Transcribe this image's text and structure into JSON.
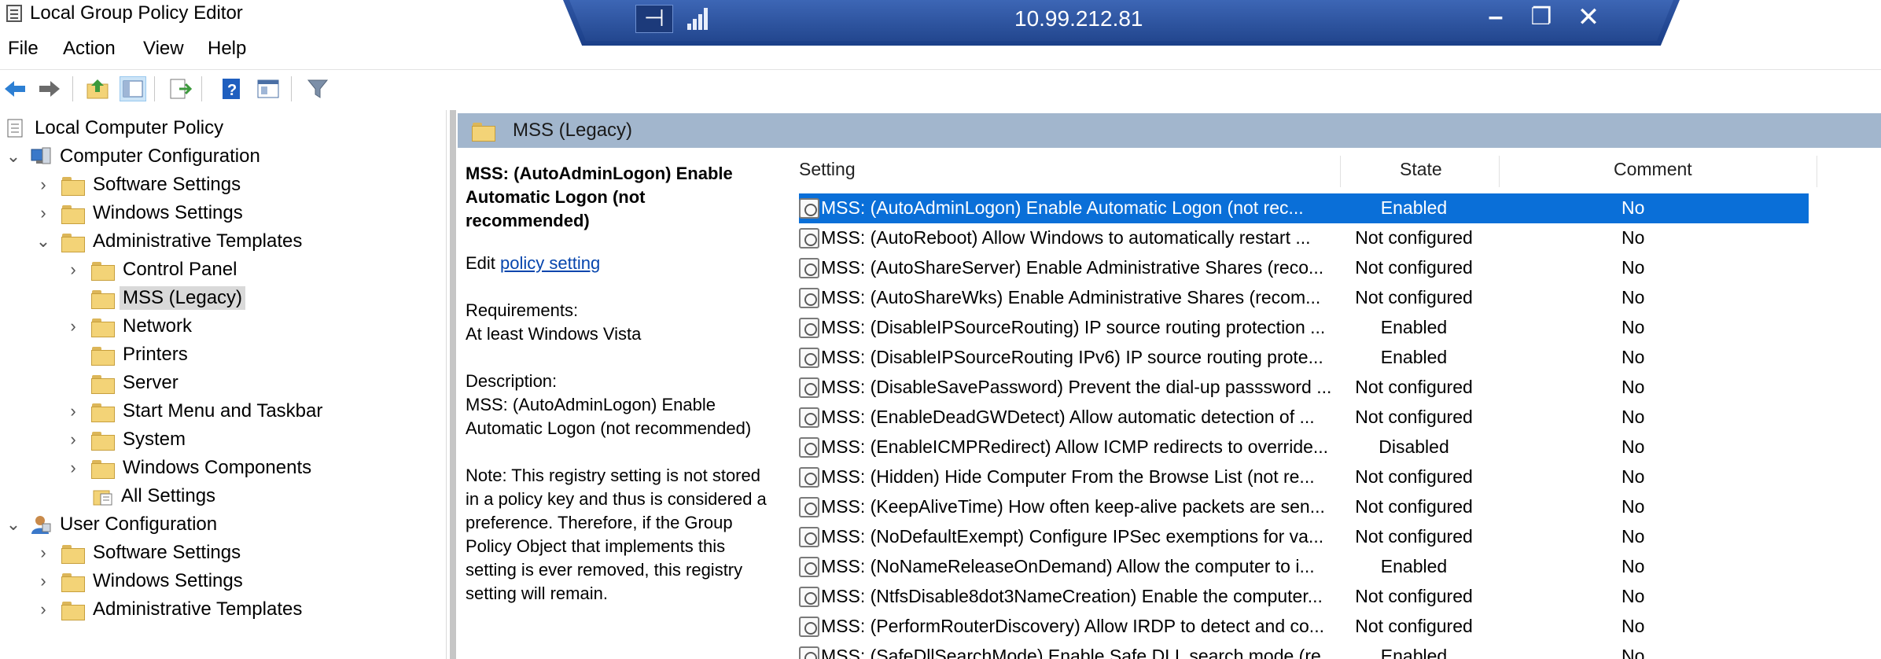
{
  "window": {
    "title": "Local Group Policy Editor"
  },
  "remote_bar": {
    "host": "10.99.212.81",
    "pin_icon": "pin-icon",
    "signal_icon": "signal-icon",
    "minimize": "–",
    "restore": "❐",
    "close": "✕"
  },
  "menu": {
    "file": "File",
    "action": "Action",
    "view": "View",
    "help": "Help"
  },
  "tree": {
    "root": "Local Computer Policy",
    "computer_configuration": "Computer Configuration",
    "cc_software_settings": "Software Settings",
    "cc_windows_settings": "Windows Settings",
    "cc_admin_templates": "Administrative Templates",
    "control_panel": "Control Panel",
    "mss_legacy": "MSS (Legacy)",
    "network": "Network",
    "printers": "Printers",
    "server": "Server",
    "start_menu": "Start Menu and Taskbar",
    "system": "System",
    "windows_components": "Windows Components",
    "all_settings": "All Settings",
    "user_configuration": "User Configuration",
    "uc_software_settings": "Software Settings",
    "uc_windows_settings": "Windows Settings",
    "uc_admin_templates": "Administrative Templates"
  },
  "header": {
    "title": "MSS (Legacy)"
  },
  "description": {
    "heading": "MSS: (AutoAdminLogon) Enable Automatic Logon (not recommended)",
    "edit_prefix": "Edit ",
    "edit_link": "policy setting ",
    "requirements_label": "Requirements:",
    "requirements_value": "At least Windows Vista",
    "description_label": "Description:",
    "description_value": "MSS: (AutoAdminLogon) Enable Automatic Logon (not recommended)",
    "note": "Note:  This registry setting is not stored in a policy key and thus is considered a preference.  Therefore, if the Group Policy Object that implements this setting is ever removed, this registry setting will remain."
  },
  "columns": {
    "setting": "Setting",
    "state": "State",
    "comment": "Comment"
  },
  "rows": [
    {
      "setting": "MSS: (AutoAdminLogon) Enable Automatic Logon (not rec...",
      "state": "Enabled",
      "comment": "No"
    },
    {
      "setting": "MSS: (AutoReboot) Allow Windows to automatically restart ...",
      "state": "Not configured",
      "comment": "No"
    },
    {
      "setting": "MSS: (AutoShareServer) Enable Administrative Shares (reco...",
      "state": "Not configured",
      "comment": "No"
    },
    {
      "setting": "MSS: (AutoShareWks) Enable Administrative Shares (recom...",
      "state": "Not configured",
      "comment": "No"
    },
    {
      "setting": "MSS: (DisableIPSourceRouting) IP source routing protection ...",
      "state": "Enabled",
      "comment": "No"
    },
    {
      "setting": "MSS: (DisableIPSourceRouting IPv6) IP source routing prote...",
      "state": "Enabled",
      "comment": "No"
    },
    {
      "setting": "MSS: (DisableSavePassword) Prevent the dial-up passsword ...",
      "state": "Not configured",
      "comment": "No"
    },
    {
      "setting": "MSS: (EnableDeadGWDetect) Allow automatic detection of ...",
      "state": "Not configured",
      "comment": "No"
    },
    {
      "setting": "MSS: (EnableICMPRedirect) Allow ICMP redirects to override...",
      "state": "Disabled",
      "comment": "No"
    },
    {
      "setting": "MSS: (Hidden) Hide Computer From the Browse List (not re...",
      "state": "Not configured",
      "comment": "No"
    },
    {
      "setting": "MSS: (KeepAliveTime) How often keep-alive packets are sen...",
      "state": "Not configured",
      "comment": "No"
    },
    {
      "setting": "MSS: (NoDefaultExempt) Configure IPSec exemptions for va...",
      "state": "Not configured",
      "comment": "No"
    },
    {
      "setting": "MSS: (NoNameReleaseOnDemand) Allow the computer to i...",
      "state": "Enabled",
      "comment": "No"
    },
    {
      "setting": "MSS: (NtfsDisable8dot3NameCreation) Enable the computer...",
      "state": "Not configured",
      "comment": "No"
    },
    {
      "setting": "MSS: (PerformRouterDiscovery) Allow IRDP to detect and co...",
      "state": "Not configured",
      "comment": "No"
    },
    {
      "setting": "MSS: (SafeDllSearchMode) Enable Safe DLL search mode (re...",
      "state": "Enabled",
      "comment": "No"
    }
  ],
  "colors": {
    "selection": "#0a6fd8",
    "header_band": "#a2b6cd",
    "remote_bar": "#2f56a4"
  }
}
